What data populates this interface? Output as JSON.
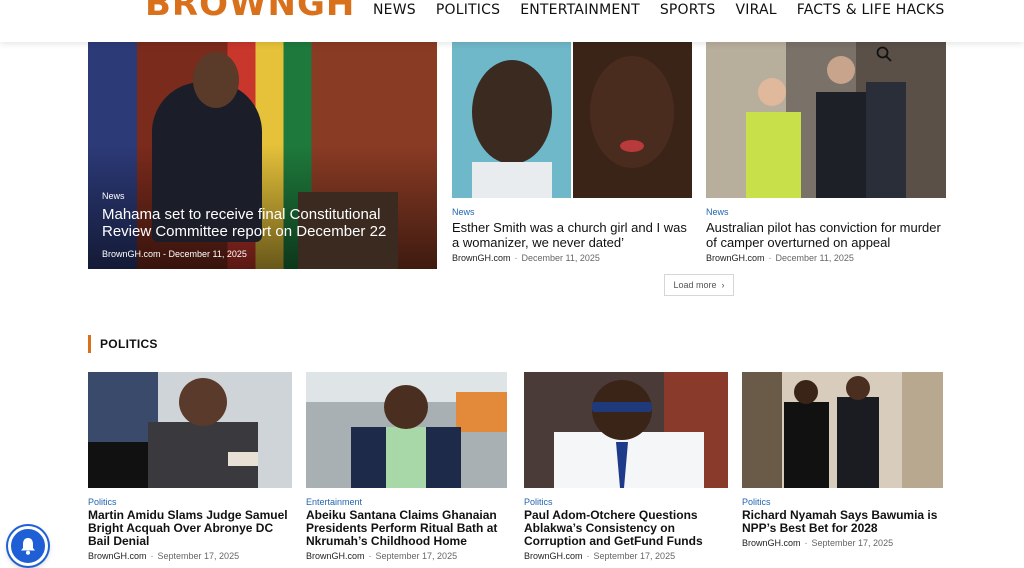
{
  "header": {
    "logo": "BROWNGH",
    "nav": [
      "NEWS",
      "POLITICS",
      "ENTERTAINMENT",
      "SPORTS",
      "VIRAL",
      "FACTS & LIFE HACKS"
    ]
  },
  "hero": {
    "category": "News",
    "title": "Mahama set to receive final Constitutional Review Committee report on December 22",
    "author": "BrownGH.com",
    "date": "December 11, 2025"
  },
  "top_cards": [
    {
      "category": "News",
      "title": "Esther Smith was a church girl and I was a womanizer, we never dated’",
      "author": "BrownGH.com",
      "date": "December 11, 2025"
    },
    {
      "category": "News",
      "title": "Australian pilot has conviction for murder of camper overturned on appeal",
      "author": "BrownGH.com",
      "date": "December 11, 2025"
    }
  ],
  "load_more": "Load more",
  "politics": {
    "heading": "POLITICS",
    "cards": [
      {
        "category": "Politics",
        "title": "Martin Amidu Slams Judge Samuel Bright Acquah Over Abronye DC Bail Denial",
        "author": "BrownGH.com",
        "date": "September 17, 2025"
      },
      {
        "category": "Entertainment",
        "title": "Abeiku Santana Claims Ghanaian Presidents Perform Ritual Bath at Nkrumah’s Childhood Home",
        "author": "BrownGH.com",
        "date": "September 17, 2025"
      },
      {
        "category": "Politics",
        "title": "Paul Adom-Otchere Questions Ablakwa’s Consistency on Corruption and GetFund Funds",
        "author": "BrownGH.com",
        "date": "September 17, 2025"
      },
      {
        "category": "Politics",
        "title": "Richard Nyamah Says Bawumia is NPP’s Best Bet for 2028",
        "author": "BrownGH.com",
        "date": "September 17, 2025"
      }
    ]
  },
  "colors": {
    "accent": "#d9701c",
    "link": "#2266b0",
    "bell": "#1e5fd6"
  }
}
